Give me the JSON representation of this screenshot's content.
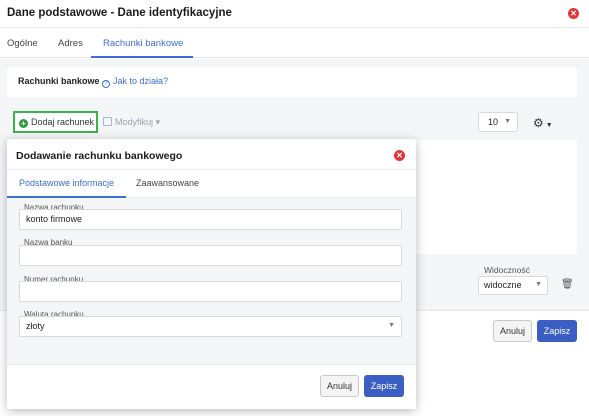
{
  "window": {
    "title": "Dane podstawowe - Dane identyfikacyjne",
    "close_icon": "close-icon",
    "tabs": [
      {
        "label": "Ogólne"
      },
      {
        "label": "Adres"
      },
      {
        "label": "Rachunki bankowe",
        "active": true
      }
    ]
  },
  "bank_section": {
    "label": "Rachunki bankowe",
    "help_link": "Jak to działa?"
  },
  "toolbar": {
    "add_label": "Dodaj rachunek",
    "modify_label": "Modyfikuj",
    "page_size": "10",
    "settings_icon": "gear-icon"
  },
  "row": {
    "visibility_label": "Widoczność",
    "visibility_value": "widoczne",
    "delete_icon": "trash-icon"
  },
  "footer": {
    "cancel_label": "Anuluj",
    "save_label": "Zapisz"
  },
  "modal": {
    "title": "Dodawanie rachunku bankowego",
    "tabs": [
      {
        "label": "Podstawowe informacje",
        "active": true
      },
      {
        "label": "Zaawansowane"
      }
    ],
    "fields": [
      {
        "label": "Nazwa rachunku",
        "value": "konto firmowe"
      },
      {
        "label": "Nazwa banku",
        "value": ""
      },
      {
        "label": "Numer rachunku",
        "value": ""
      },
      {
        "label": "Waluta rachunku",
        "value": "złoty"
      }
    ],
    "cancel_label": "Anuluj",
    "save_label": "Zapisz"
  },
  "colors": {
    "accent": "#3a6fd8",
    "primary_button": "#3a5ec4",
    "close": "#e1353a",
    "add_highlight": "#3bb24a"
  }
}
